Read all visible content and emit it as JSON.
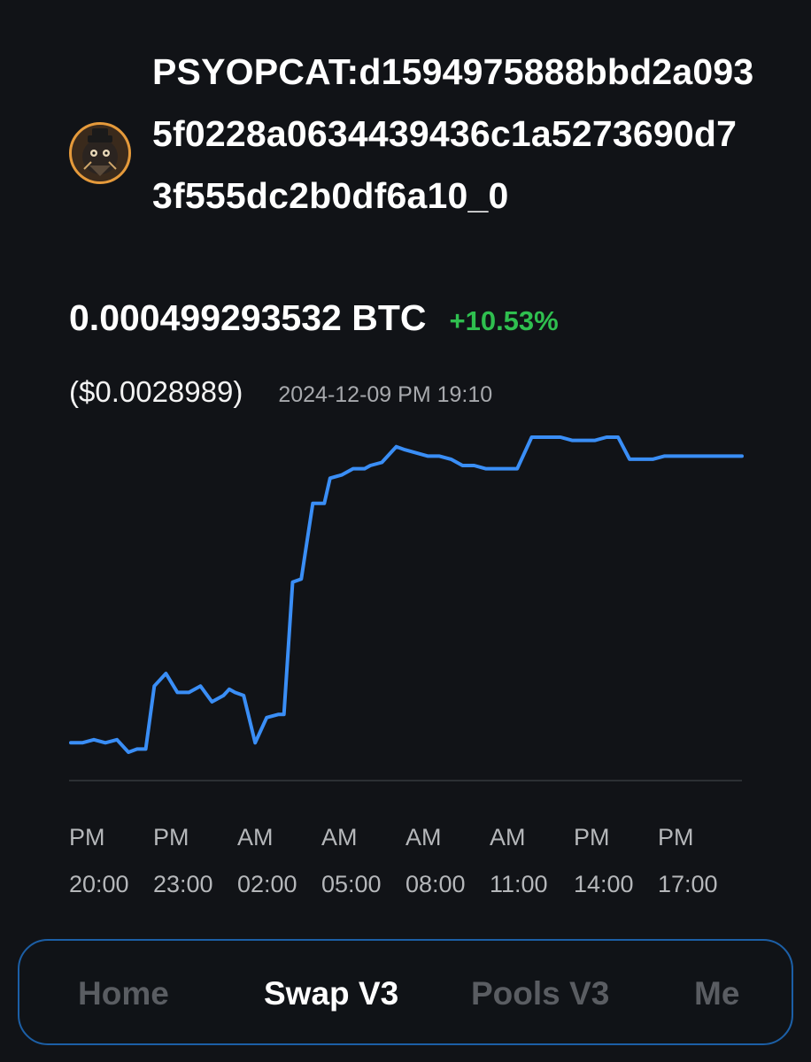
{
  "token": {
    "name": "PSYOPCAT:d1594975888bbd2a0935f0228a0634439436c1a5273690d73f555dc2b0df6a10_0",
    "avatar_icon": "psyopcat-avatar-icon"
  },
  "price": {
    "btc": "0.000499293532 BTC",
    "change": "+10.53%",
    "change_color": "#2fbf4f",
    "usd": "($0.0028989)",
    "timestamp": "2024-12-09 PM 19:10"
  },
  "chart_data": {
    "type": "line",
    "line_color": "#3a8ef6",
    "grid": false,
    "x_tick_labels": [
      {
        "period": "PM",
        "time": "20:00"
      },
      {
        "period": "PM",
        "time": "23:00"
      },
      {
        "period": "AM",
        "time": "02:00"
      },
      {
        "period": "AM",
        "time": "05:00"
      },
      {
        "period": "AM",
        "time": "08:00"
      },
      {
        "period": "AM",
        "time": "11:00"
      },
      {
        "period": "PM",
        "time": "14:00"
      },
      {
        "period": "PM",
        "time": "17:00"
      }
    ],
    "x_hours": [
      0,
      0.4,
      0.8,
      1.2,
      1.6,
      2.0,
      2.3,
      2.6,
      2.9,
      3.3,
      3.7,
      4.1,
      4.5,
      4.9,
      5.3,
      5.5,
      5.7,
      6.0,
      6.4,
      6.8,
      7.2,
      7.4,
      7.7,
      8.0,
      8.4,
      8.8,
      9.0,
      9.4,
      9.8,
      10.2,
      10.4,
      10.8,
      11.3,
      11.6,
      12.0,
      12.4,
      12.8,
      13.2,
      13.6,
      14.0,
      14.4,
      14.8,
      15.2,
      15.5,
      16.0,
      16.5,
      17.0,
      17.4,
      17.8,
      18.2,
      18.6,
      19.0,
      19.4,
      19.8,
      20.2,
      20.6,
      21.0,
      21.4,
      21.8,
      22.2,
      22.6,
      23.0,
      23.3
    ],
    "y_values": [
      4.2,
      4.2,
      4.3,
      4.2,
      4.3,
      3.9,
      4.0,
      4.0,
      6.0,
      6.4,
      5.8,
      5.8,
      6.0,
      5.5,
      5.7,
      5.9,
      5.8,
      5.7,
      4.2,
      5.0,
      5.1,
      5.1,
      9.3,
      9.4,
      11.8,
      11.8,
      12.6,
      12.7,
      12.9,
      12.9,
      13.0,
      13.1,
      13.6,
      13.5,
      13.4,
      13.3,
      13.3,
      13.2,
      13.0,
      13.0,
      12.9,
      12.9,
      12.9,
      12.9,
      13.9,
      13.9,
      13.9,
      13.8,
      13.8,
      13.8,
      13.9,
      13.9,
      13.2,
      13.2,
      13.2,
      13.3,
      13.3,
      13.3,
      13.3,
      13.3,
      13.3,
      13.3,
      13.3
    ],
    "y_units": "relative"
  },
  "nav": {
    "items": [
      {
        "label": "Home",
        "active": false
      },
      {
        "label": "Swap V3",
        "active": true
      },
      {
        "label": "Pools V3",
        "active": false
      },
      {
        "label": "Me",
        "active": false
      }
    ],
    "border_color": "#1c5fa6"
  }
}
